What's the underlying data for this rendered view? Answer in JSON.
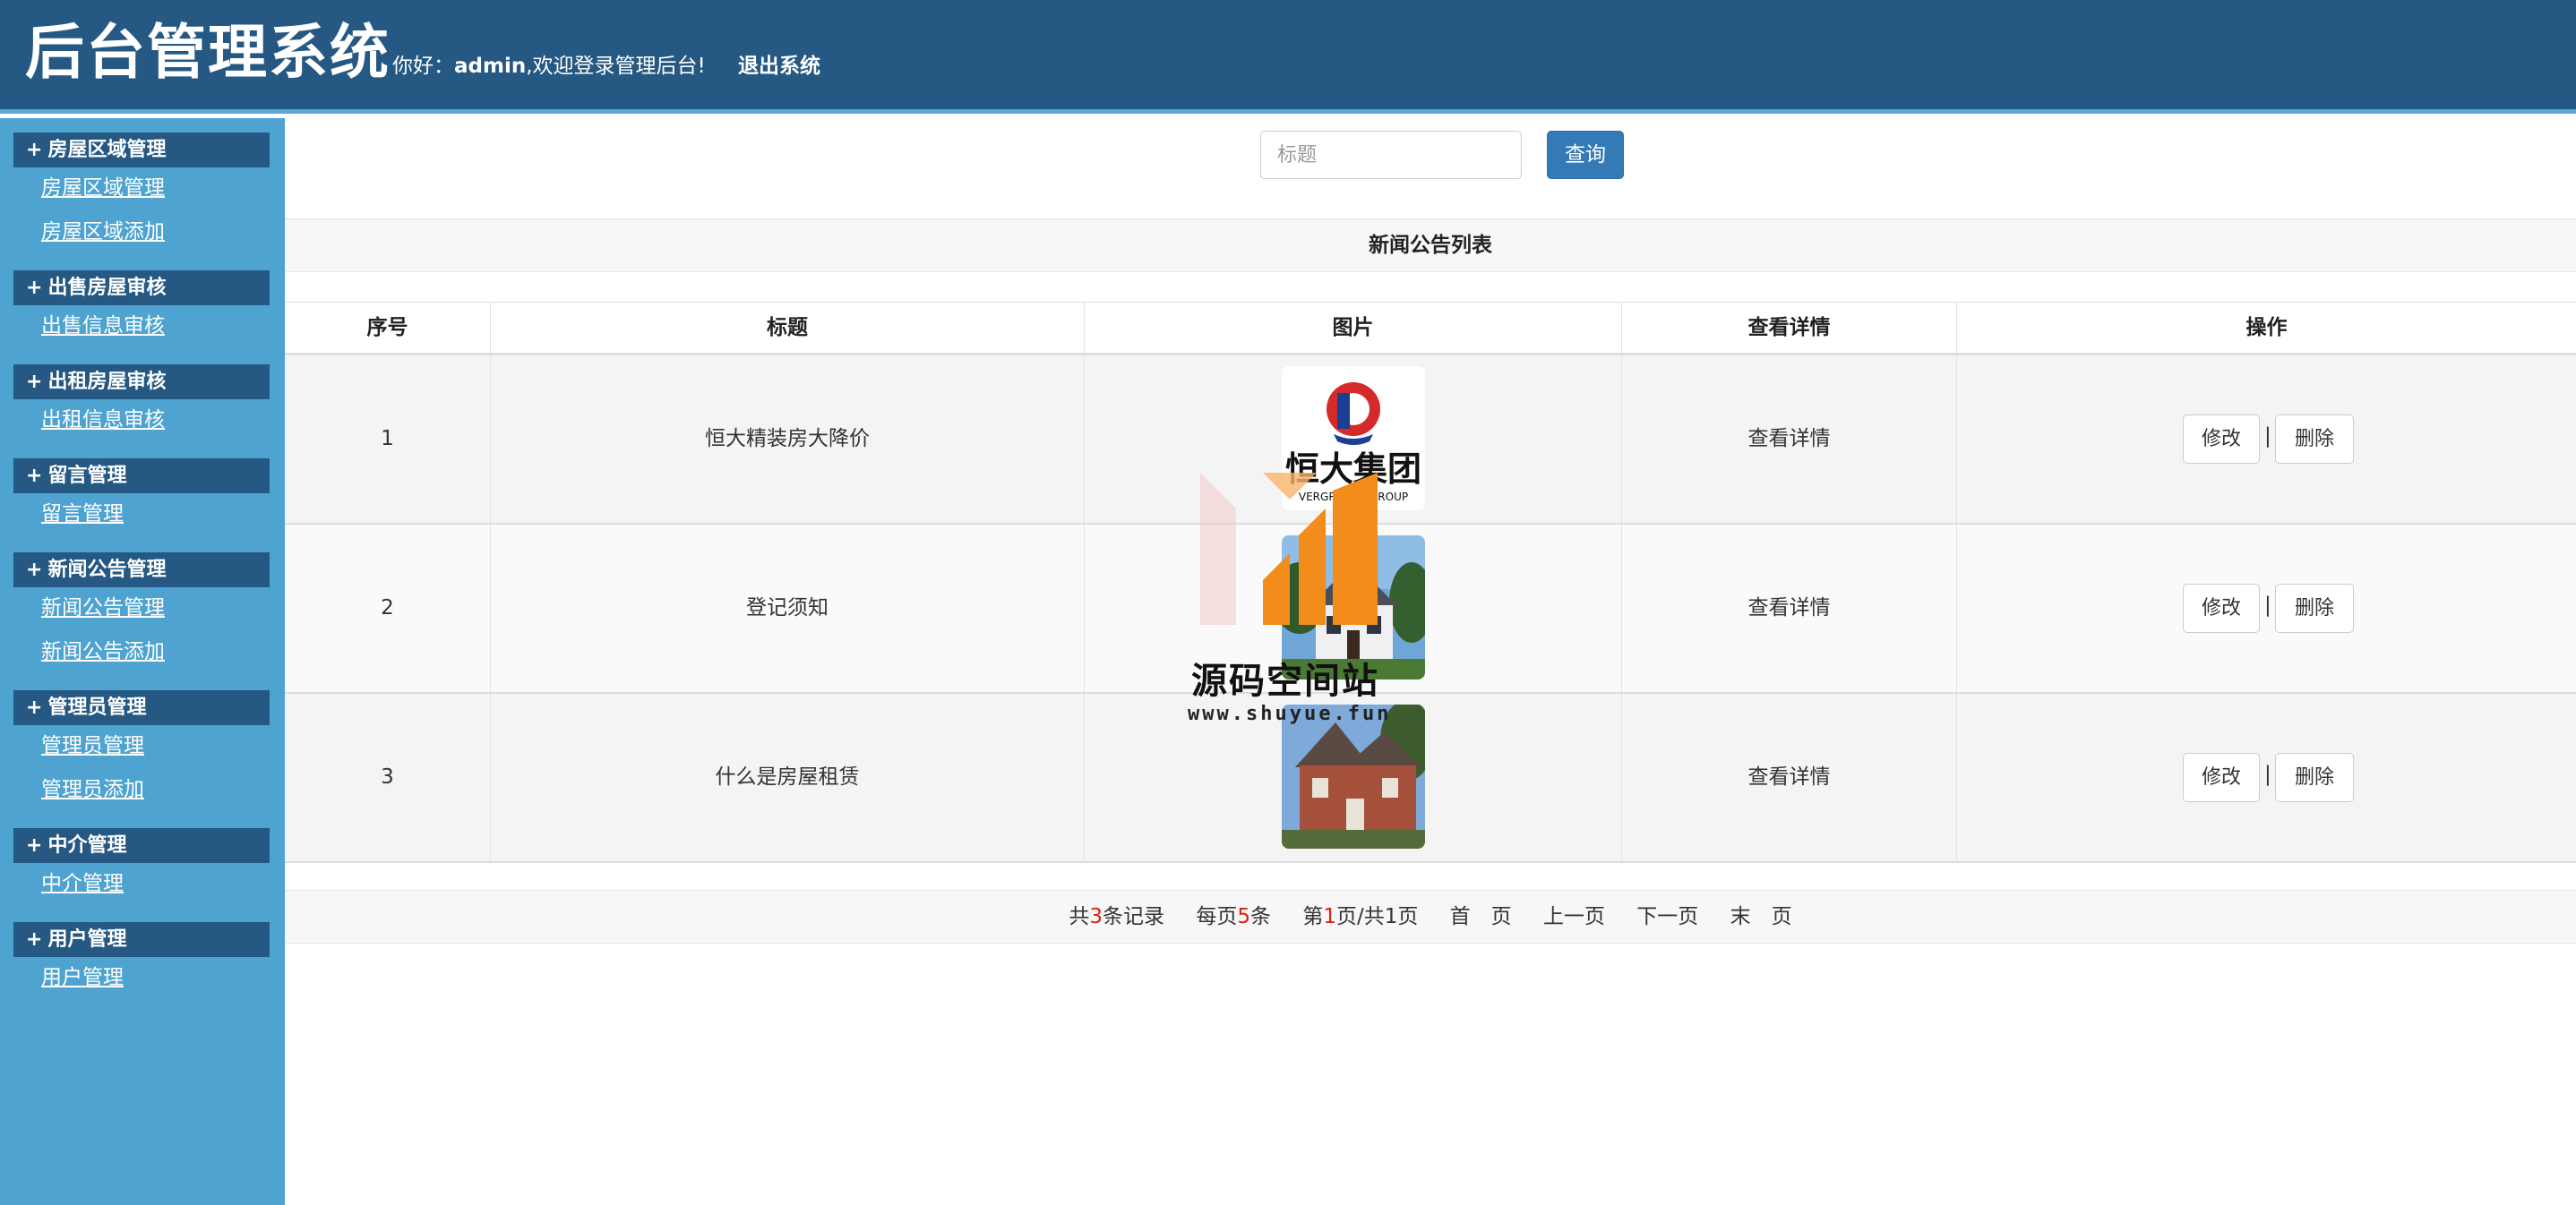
{
  "header": {
    "title": "后台管理系统",
    "welcome_prefix": "你好：",
    "username": "admin",
    "welcome_suffix": ",欢迎登录管理后台!",
    "logout_label": "退出系统"
  },
  "sidebar": {
    "groups": [
      {
        "title": "房屋区域管理",
        "links": [
          "房屋区域管理",
          "房屋区域添加"
        ]
      },
      {
        "title": "出售房屋审核",
        "links": [
          "出售信息审核"
        ]
      },
      {
        "title": "出租房屋审核",
        "links": [
          "出租信息审核"
        ]
      },
      {
        "title": "留言管理",
        "links": [
          "留言管理"
        ]
      },
      {
        "title": "新闻公告管理",
        "links": [
          "新闻公告管理",
          "新闻公告添加"
        ]
      },
      {
        "title": "管理员管理",
        "links": [
          "管理员管理",
          "管理员添加"
        ]
      },
      {
        "title": "中介管理",
        "links": [
          "中介管理"
        ]
      },
      {
        "title": "用户管理",
        "links": [
          "用户管理"
        ]
      }
    ],
    "plus_symbol": "+"
  },
  "search": {
    "placeholder": "标题",
    "value": "",
    "button_label": "查询"
  },
  "table": {
    "caption": "新闻公告列表",
    "columns": [
      "序号",
      "标题",
      "图片",
      "查看详情",
      "操作"
    ],
    "rows": [
      {
        "index": "1",
        "title": "恒大精装房大降价",
        "image": "evergrande-logo",
        "detail": "查看详情",
        "edit": "修改",
        "delete": "删除",
        "sep": "|"
      },
      {
        "index": "2",
        "title": "登记须知",
        "image": "white-house-photo",
        "detail": "查看详情",
        "edit": "修改",
        "delete": "删除",
        "sep": "|"
      },
      {
        "index": "3",
        "title": "什么是房屋租赁",
        "image": "brick-house-photo",
        "detail": "查看详情",
        "edit": "修改",
        "delete": "删除",
        "sep": "|"
      }
    ],
    "logo_text": "恒大集团",
    "logo_subtext": "VERGRANDE GROUP"
  },
  "pager": {
    "total_prefix": "共",
    "total": "3",
    "total_suffix": "条记录",
    "per_prefix": "每页",
    "per_page": "5",
    "per_suffix": "条",
    "page_prefix": "第",
    "page": "1",
    "page_suffix": "页/共1页",
    "first": "首　页",
    "prev": "上一页",
    "next": "下一页",
    "last": "末　页"
  },
  "watermark": {
    "text": "源码空间站",
    "url": "www.shuyue.fun"
  },
  "colors": {
    "header_bg": "#255882",
    "sidebar_bg": "#4ea3d0",
    "primary_button": "#337ab7",
    "accent_red": "#d9230f"
  }
}
